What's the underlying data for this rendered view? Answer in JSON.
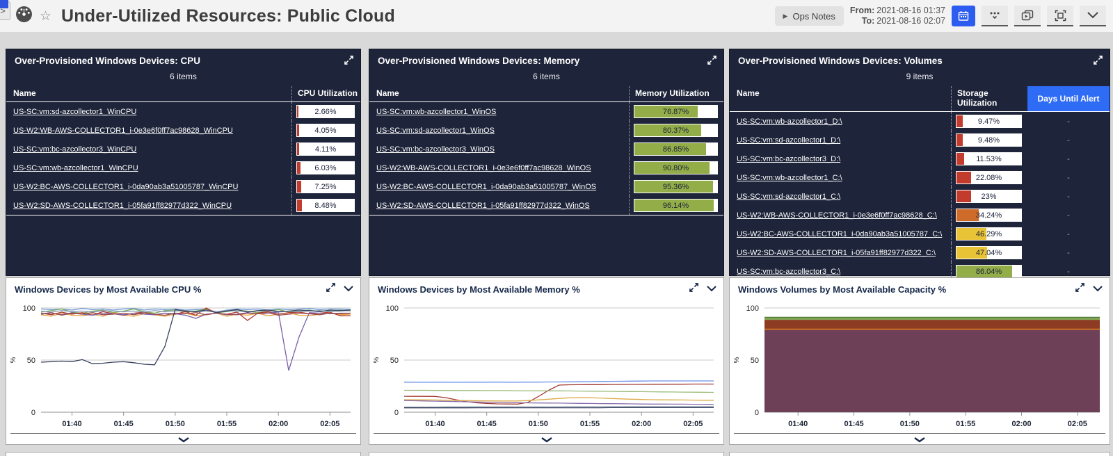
{
  "header": {
    "title": "Under-Utilized Resources: Public Cloud",
    "ops_notes_label": "Ops Notes",
    "from_label": "From:",
    "from_value": "2021-08-16 01:37",
    "to_label": "To:",
    "to_value": "2021-08-16 02:07",
    "accent_blue": "#2d5cf0"
  },
  "panels": [
    {
      "title": "Over-Provisioned Windows Devices: CPU",
      "items_count": "6 items",
      "columns": [
        "Name",
        "CPU Utilization"
      ],
      "rows": [
        {
          "name": "US-SC:vm:sd-azcollector1_WinCPU",
          "value": "2.66%",
          "color": "#c23b2c"
        },
        {
          "name": "US-W2:WB-AWS-COLLECTOR1_i-0e3e6f0ff7ac98628_WinCPU",
          "value": "4.05%",
          "color": "#c23b2c"
        },
        {
          "name": "US-SC:vm:bc-azcollector3_WinCPU",
          "value": "4.11%",
          "color": "#c23b2c"
        },
        {
          "name": "US-SC:vm:wb-azcollector1_WinCPU",
          "value": "6.03%",
          "color": "#c23b2c"
        },
        {
          "name": "US-W2:BC-AWS-COLLECTOR1_i-0da90ab3a51005787_WinCPU",
          "value": "7.25%",
          "color": "#c23b2c"
        },
        {
          "name": "US-W2:SD-AWS-COLLECTOR1_i-05fa91ff82977d322_WinCPU",
          "value": "8.48%",
          "color": "#c23b2c"
        }
      ]
    },
    {
      "title": "Over-Provisioned Windows Devices: Memory",
      "items_count": "6 items",
      "columns": [
        "Name",
        "Memory Utilization"
      ],
      "rows": [
        {
          "name": "US-SC:vm:wb-azcollector1_WinOS",
          "value": "76.87%",
          "color": "#93ae49"
        },
        {
          "name": "US-SC:vm:sd-azcollector1_WinOS",
          "value": "80.37%",
          "color": "#93ae49"
        },
        {
          "name": "US-SC:vm:bc-azcollector3_WinOS",
          "value": "86.85%",
          "color": "#93ae49"
        },
        {
          "name": "US-W2:WB-AWS-COLLECTOR1_i-0e3e6f0ff7ac98628_WinOS",
          "value": "90.80%",
          "color": "#93ae49"
        },
        {
          "name": "US-W2:BC-AWS-COLLECTOR1_i-0da90ab3a51005787_WinOS",
          "value": "95.36%",
          "color": "#93ae49"
        },
        {
          "name": "US-W2:SD-AWS-COLLECTOR1_i-05fa91ff82977d322_WinOS",
          "value": "96.14%",
          "color": "#93ae49"
        }
      ]
    },
    {
      "title": "Over-Provisioned Windows Devices: Volumes",
      "items_count": "9 items",
      "columns": [
        "Name",
        "Storage Utilization",
        "Days Until Alert"
      ],
      "days_header_color": "#2e6cf6",
      "rows": [
        {
          "name": "US-SC:vm:wb-azcollector1_D:\\",
          "value": "9.47%",
          "color": "#c23b2c",
          "days": "-"
        },
        {
          "name": "US-SC:vm:sd-azcollector1_D:\\",
          "value": "9.48%",
          "color": "#c23b2c",
          "days": "-"
        },
        {
          "name": "US-SC:vm:bc-azcollector3_D:\\",
          "value": "11.53%",
          "color": "#c23b2c",
          "days": "-"
        },
        {
          "name": "US-SC:vm:wb-azcollector1_C:\\",
          "value": "22.08%",
          "color": "#c23b2c",
          "days": "-"
        },
        {
          "name": "US-SC:vm:sd-azcollector1_C:\\",
          "value": "23%",
          "color": "#c23b2c",
          "days": "-"
        },
        {
          "name": "US-W2:WB-AWS-COLLECTOR1_i-0e3e6f0ff7ac98628_C:\\",
          "value": "34.24%",
          "color": "#cf6b28",
          "days": "-"
        },
        {
          "name": "US-W2:BC-AWS-COLLECTOR1_i-0da90ab3a51005787_C:\\",
          "value": "46.29%",
          "color": "#e8c335",
          "days": "-"
        },
        {
          "name": "US-W2:SD-AWS-COLLECTOR1_i-05fa91ff82977d322_C:\\",
          "value": "47.04%",
          "color": "#e8c335",
          "days": "-"
        },
        {
          "name": "US-SC:vm:bc-azcollector3_C:\\",
          "value": "86.04%",
          "color": "#93ae49",
          "days": "-"
        }
      ]
    }
  ],
  "charts": [
    {
      "title": "Windows Devices by Most Available CPU %",
      "type": "line",
      "ylabel": "%",
      "yticks": [
        0,
        50,
        100
      ],
      "ylim": [
        0,
        100
      ],
      "n": 31,
      "xtick_idx": [
        3,
        8,
        13,
        18,
        23,
        28
      ],
      "xticklabels": [
        "01:40",
        "01:45",
        "01:50",
        "01:55",
        "02:00",
        "02:05"
      ],
      "series": [
        {
          "color": "#6b9bd8",
          "values": [
            99,
            98.5,
            99,
            98,
            99.5,
            98.5,
            99,
            98,
            99,
            99.5,
            98,
            99,
            98.5,
            99,
            98,
            98.5,
            99,
            96,
            98,
            99,
            98.5,
            99,
            98,
            99,
            98.5,
            99,
            99.5,
            98.5,
            99,
            99,
            98.5
          ]
        },
        {
          "color": "#7fae5a",
          "values": [
            96,
            97.5,
            99,
            96,
            95,
            97,
            98,
            95.5,
            97,
            99,
            96.5,
            95,
            97.5,
            98,
            96,
            97,
            99,
            95.5,
            96.5,
            98,
            97,
            95.5,
            97,
            98.5,
            96,
            97,
            98,
            96.5,
            97.5,
            98,
            97
          ]
        },
        {
          "color": "#e6a23c",
          "values": [
            93.5,
            92,
            95,
            93,
            92.5,
            94,
            92,
            95.5,
            93,
            92,
            94.5,
            93.5,
            92,
            94,
            95,
            92.5,
            93.5,
            95,
            92,
            94,
            93,
            95,
            92.5,
            94,
            95.5,
            93,
            92.5,
            94,
            95,
            93.5,
            94
          ]
        },
        {
          "color": "#b03a2e",
          "values": [
            95,
            93.5,
            96,
            94,
            95.5,
            93,
            96.5,
            94.5,
            93,
            95,
            96,
            93.5,
            95,
            94,
            96.5,
            93,
            100,
            95,
            94,
            96,
            88,
            95,
            96.5,
            94,
            95.5,
            96,
            94.5,
            95,
            96,
            92.5,
            92.5
          ]
        },
        {
          "color": "#7a5fa8",
          "values": [
            94,
            95,
            93.5,
            95.5,
            94,
            93,
            95,
            94.5,
            93.5,
            95,
            94,
            93.5,
            95,
            94.5,
            93,
            90,
            94,
            95,
            93.5,
            94,
            95.5,
            94.5,
            95,
            96,
            40,
            72,
            95.5,
            95,
            94.5,
            95,
            95
          ]
        },
        {
          "color": "#9c4a4a",
          "values": [
            94.5,
            95.5,
            93,
            95,
            94,
            95.5,
            93.5,
            94,
            95,
            93.5,
            95.5,
            94,
            93,
            95,
            94.5,
            95.5,
            93.5,
            95,
            94,
            93.5,
            95,
            94.5,
            95.5,
            93,
            94,
            95,
            94.5,
            93.5,
            95,
            94.5,
            95
          ]
        },
        {
          "color": "#8898b8",
          "values": [
            97,
            96,
            97.5,
            96.5,
            97,
            96,
            97.5,
            97,
            96.5,
            97,
            96,
            97.5,
            96.5,
            97,
            97.5,
            96,
            97,
            96.5,
            97.5,
            97,
            96.5,
            97,
            97.5,
            96,
            97,
            96.5,
            97,
            97.5,
            96.5,
            97,
            97.5
          ]
        },
        {
          "color": "#36405e",
          "values": [
            48,
            48.5,
            49,
            48.5,
            50.5,
            46.5,
            47,
            48,
            48.5,
            47.5,
            46,
            45.5,
            63,
            98.5,
            97,
            96.5,
            98,
            95.5,
            97,
            98.5,
            96,
            97.5,
            98,
            96.5,
            97,
            98,
            97.5,
            96.5,
            98,
            97.5,
            98
          ]
        }
      ]
    },
    {
      "title": "Windows Devices by Most Available Memory %",
      "type": "line",
      "ylabel": "%",
      "yticks": [
        0,
        50,
        100
      ],
      "ylim": [
        0,
        100
      ],
      "n": 31,
      "xtick_idx": [
        3,
        8,
        13,
        18,
        23,
        28
      ],
      "xticklabels": [
        "01:40",
        "01:45",
        "01:50",
        "01:55",
        "02:00",
        "02:05"
      ],
      "series": [
        {
          "color": "#6c8fe8",
          "values": [
            28.8,
            28.8,
            28.7,
            28.8,
            28.8,
            28.7,
            28.8,
            28.8,
            28.8,
            28.9,
            28.8,
            28.8,
            28.9,
            28.9,
            29,
            29,
            29.1,
            29.2,
            29.3,
            29.5,
            29.6,
            29.7,
            29.8,
            29.9,
            30,
            30,
            30,
            30,
            30,
            30,
            30
          ]
        },
        {
          "color": "#a33b33",
          "values": [
            15.3,
            15.2,
            15.2,
            15.1,
            14,
            12,
            10.3,
            9,
            8.4,
            8,
            7.9,
            7.8,
            9.5,
            15,
            21,
            26,
            26.3,
            26.4,
            26.5,
            26.5,
            26.6,
            26.6,
            26.7,
            26.7,
            26.8,
            26.8,
            26.9,
            26.9,
            27,
            27,
            27
          ]
        },
        {
          "color": "#9cbb7a",
          "values": [
            21,
            21,
            21,
            20.9,
            20.9,
            20.8,
            20.8,
            20.8,
            20.7,
            20.7,
            20.7,
            20.6,
            20.6,
            20.6,
            20.5,
            20.5,
            20.4,
            20.3,
            20.2,
            20.1,
            20,
            19.9,
            19.8,
            19.7,
            19.6,
            19.5,
            19.4,
            19.3,
            19.2,
            19.1,
            19
          ]
        },
        {
          "color": "#ddab48",
          "values": [
            12,
            11.9,
            11.8,
            11.7,
            11.5,
            11.3,
            11.1,
            11,
            10.9,
            10.8,
            10.8,
            10.9,
            11.2,
            11.8,
            12.5,
            13.2,
            13.8,
            14,
            13.9,
            13.6,
            13.2,
            12.8,
            12.5,
            12.2,
            12,
            11.9,
            11.8,
            11.7,
            11.6,
            11.5,
            11.5
          ]
        },
        {
          "color": "#8a6fae",
          "values": [
            11.2,
            11,
            10.8,
            10.6,
            10.4,
            10.2,
            10,
            9.8,
            9.6,
            9.4,
            9.3,
            9.1,
            9,
            8.9,
            8.8,
            8.7,
            8.6,
            8.5,
            8.4,
            8.3,
            8.2,
            8.1,
            8,
            7.9,
            7.8,
            7.8,
            7.7,
            7.7,
            7.6,
            7.6,
            7.5
          ]
        },
        {
          "color": "#9aa5b5",
          "values": [
            5,
            5,
            5,
            5,
            5.1,
            5.1,
            5.1,
            5.2,
            5.2,
            5.2,
            5.2,
            5.3,
            5.3,
            5.3,
            5.3,
            5.3,
            5.4,
            5.4,
            5.4,
            5.4,
            5.4,
            5.4,
            5.5,
            5.5,
            5.5,
            5.5,
            5.5,
            5.5,
            5.5,
            5.5,
            5.5
          ]
        },
        {
          "color": "#36405e",
          "values": [
            4.2,
            4.2,
            4.2,
            4.2,
            4.2,
            4.2,
            4.2,
            4.3,
            4.3,
            4.3,
            4.3,
            4.3,
            4.3,
            4.3,
            4.3,
            4.3,
            4.3,
            4.3,
            4.3,
            4.3,
            4.4,
            4.4,
            4.4,
            4.4,
            4.4,
            4.4,
            4.4,
            4.4,
            4.4,
            4.4,
            4.4
          ]
        }
      ]
    },
    {
      "title": "Windows Volumes by Most Available Capacity %",
      "type": "area",
      "ylabel": "%",
      "yticks": [
        0,
        50,
        100
      ],
      "ylim": [
        0,
        100
      ],
      "n": 31,
      "xtick_idx": [
        3,
        8,
        13,
        18,
        23,
        28
      ],
      "xticklabels": [
        "01:40",
        "01:45",
        "01:50",
        "01:55",
        "02:00",
        "02:05"
      ],
      "series": [
        {
          "color": "#84a655",
          "stroke": "#4c7d3c",
          "values": [
            91,
            91
          ]
        },
        {
          "color": "#8d3b23",
          "values": [
            88.5,
            88.5
          ]
        },
        {
          "color": "#d4761f",
          "values": [
            80.2,
            80.2
          ]
        },
        {
          "color": "#6e4058",
          "values": [
            79,
            79
          ]
        }
      ]
    }
  ]
}
